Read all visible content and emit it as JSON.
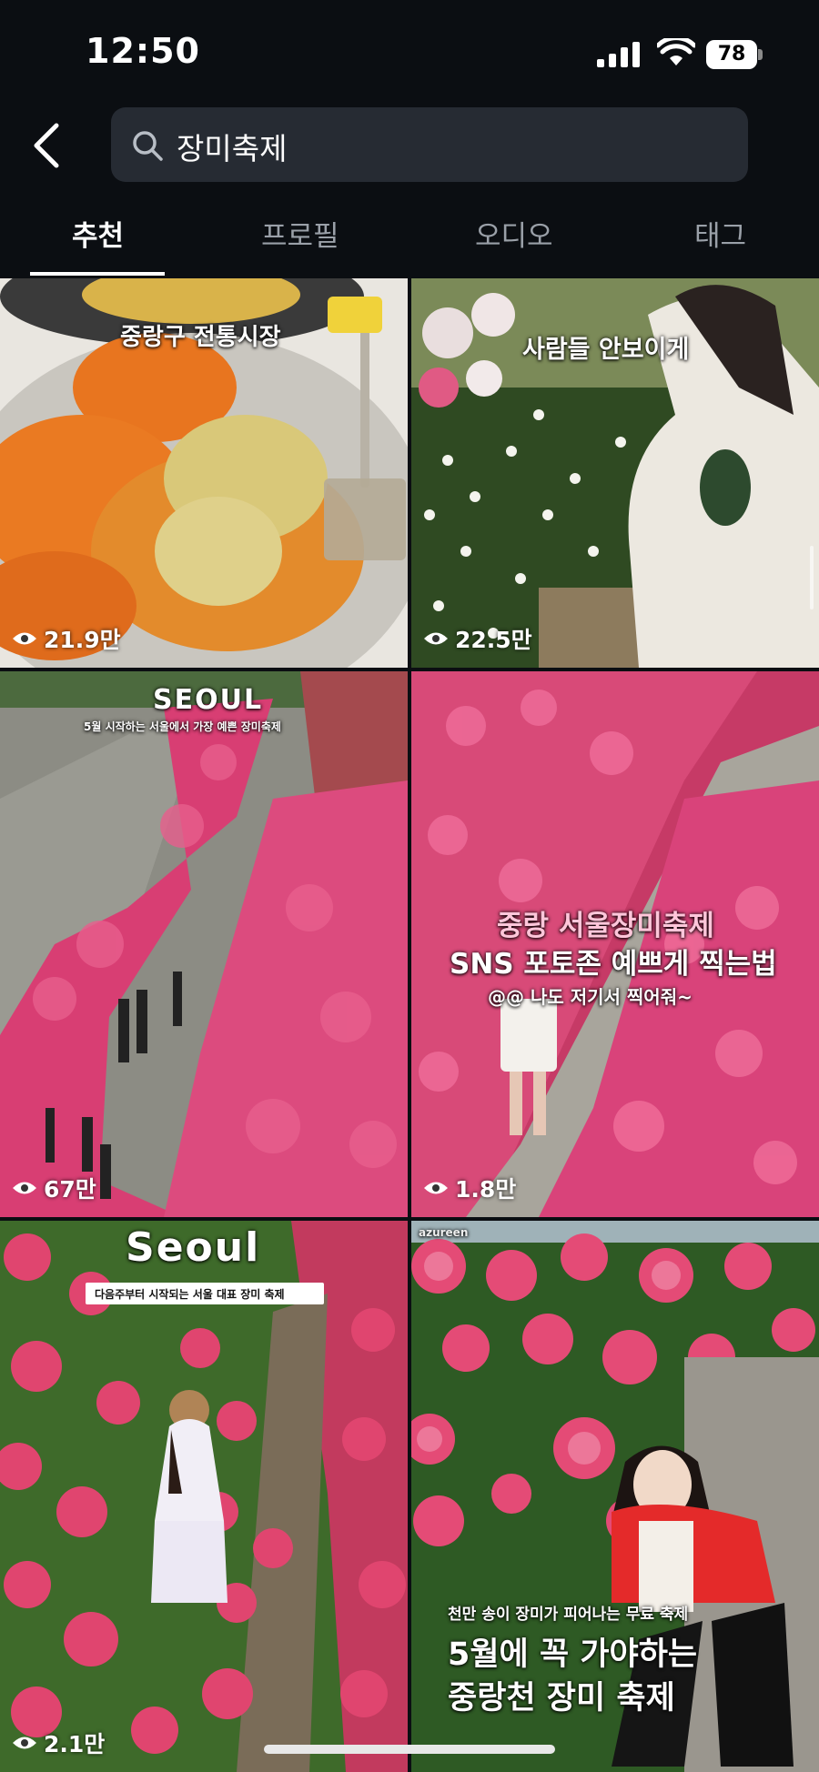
{
  "status_bar": {
    "time": "12:50",
    "battery": "78"
  },
  "search": {
    "query": "장미축제"
  },
  "tabs": [
    "추천",
    "프로필",
    "오디오",
    "태그"
  ],
  "grid": [
    {
      "caption": "중랑구 전통시장",
      "views": "21.9만"
    },
    {
      "caption": "사람들 안보이게",
      "views": "22.5만"
    },
    {
      "caption_big": "SEOUL",
      "caption_small": "5월 시작하는 서울에서 가장 예쁜 장미축제",
      "views": "67만"
    },
    {
      "caption_lines": [
        "중랑 서울장미축제",
        "SNS 포토존 예쁘게 찍는법",
        "@@ 나도 저기서 찍어줘~"
      ],
      "views": "1.8만"
    },
    {
      "caption_big": "Seoul",
      "caption_small": "다음주부터 시작되는 서울 대표 장미 축제",
      "views": "2.1만"
    },
    {
      "caption_lines": [
        "천만 송이 장미가 피어나는 무료 축제",
        "5월에 꼭 가야하는",
        "중랑천 장미 축제"
      ],
      "watermark": "azureen"
    }
  ],
  "colors": {
    "background": "#0b0e12",
    "search_bg": "#262b33",
    "rose": "#e23a6b",
    "tab_inactive": "#9aa0a8"
  }
}
